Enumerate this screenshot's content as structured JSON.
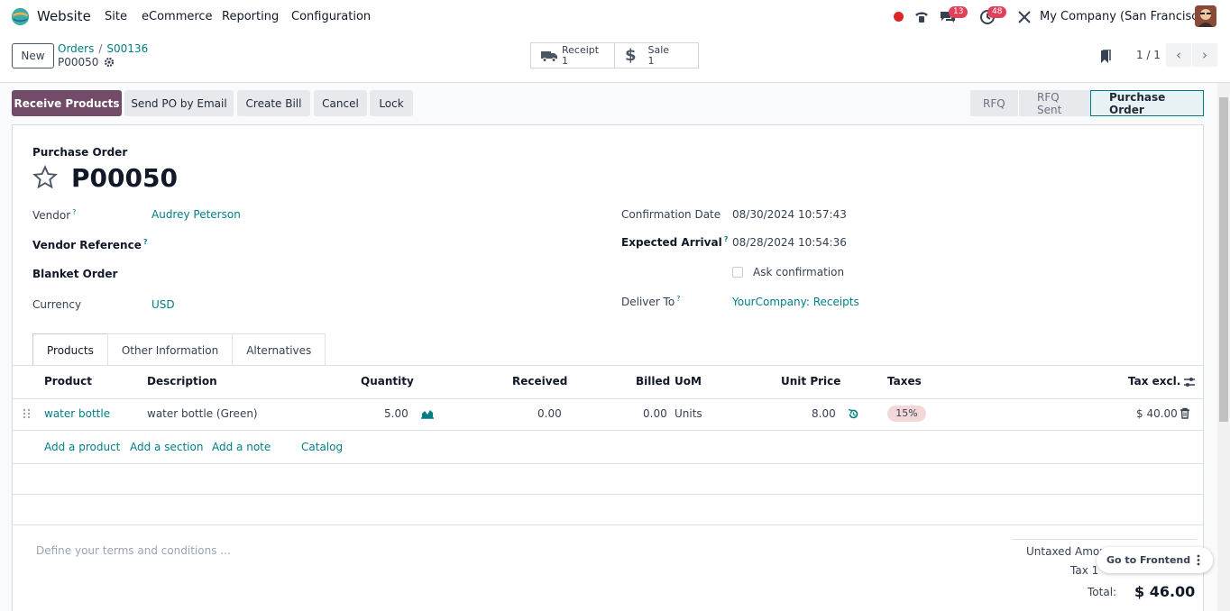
{
  "navbar": {
    "brand": "Website",
    "menu": [
      "Site",
      "eCommerce",
      "Reporting",
      "Configuration"
    ],
    "messages_count": "13",
    "activities_count": "48",
    "company": "My Company (San Francisco)"
  },
  "control_panel": {
    "new_label": "New",
    "breadcrumb": [
      "Orders",
      "S00136"
    ],
    "record_name": "P00050",
    "smart_buttons": [
      {
        "label": "Receipt",
        "count": "1",
        "icon": "truck-icon"
      },
      {
        "label": "Sale",
        "count": "1",
        "icon": "dollar-icon"
      }
    ],
    "pager": "1 / 1"
  },
  "actions": {
    "receive_products": "Receive Products",
    "send_po": "Send PO by Email",
    "create_bill": "Create Bill",
    "cancel": "Cancel",
    "lock": "Lock"
  },
  "statusbar": [
    "RFQ",
    "RFQ Sent",
    "Purchase Order"
  ],
  "form": {
    "title_label": "Purchase Order",
    "po_number": "P00050",
    "vendor_label": "Vendor",
    "vendor": "Audrey Peterson",
    "vendor_ref_label": "Vendor Reference",
    "blanket_label": "Blanket Order",
    "currency_label": "Currency",
    "currency": "USD",
    "confirmation_date_label": "Confirmation Date",
    "confirmation_date": "08/30/2024 10:57:43",
    "expected_arrival_label": "Expected Arrival",
    "expected_arrival": "08/28/2024 10:54:36",
    "ask_confirmation": "Ask confirmation",
    "deliver_to_label": "Deliver To",
    "deliver_to": "YourCompany: Receipts",
    "help_mark": "?"
  },
  "tabs": [
    "Products",
    "Other Information",
    "Alternatives"
  ],
  "lines": {
    "headers": {
      "product": "Product",
      "description": "Description",
      "quantity": "Quantity",
      "received": "Received",
      "billed": "Billed",
      "uom": "UoM",
      "unit_price": "Unit Price",
      "taxes": "Taxes",
      "tax_excl": "Tax excl."
    },
    "rows": [
      {
        "product": "water bottle",
        "description": "water bottle (Green)",
        "quantity": "5.00",
        "received": "0.00",
        "billed": "0.00",
        "uom": "Units",
        "unit_price": "8.00",
        "tax": "15%",
        "subtotal": "$ 40.00"
      }
    ],
    "add_product": "Add a product",
    "add_section": "Add a section",
    "add_note": "Add a note",
    "catalog": "Catalog"
  },
  "footer": {
    "terms_placeholder": "Define your terms and conditions ...",
    "untaxed_label": "Untaxed Amou",
    "tax_label": "Tax 1",
    "total_label": "Total:",
    "total": "$ 46.00"
  },
  "go_to_frontend": "Go to Frontend"
}
